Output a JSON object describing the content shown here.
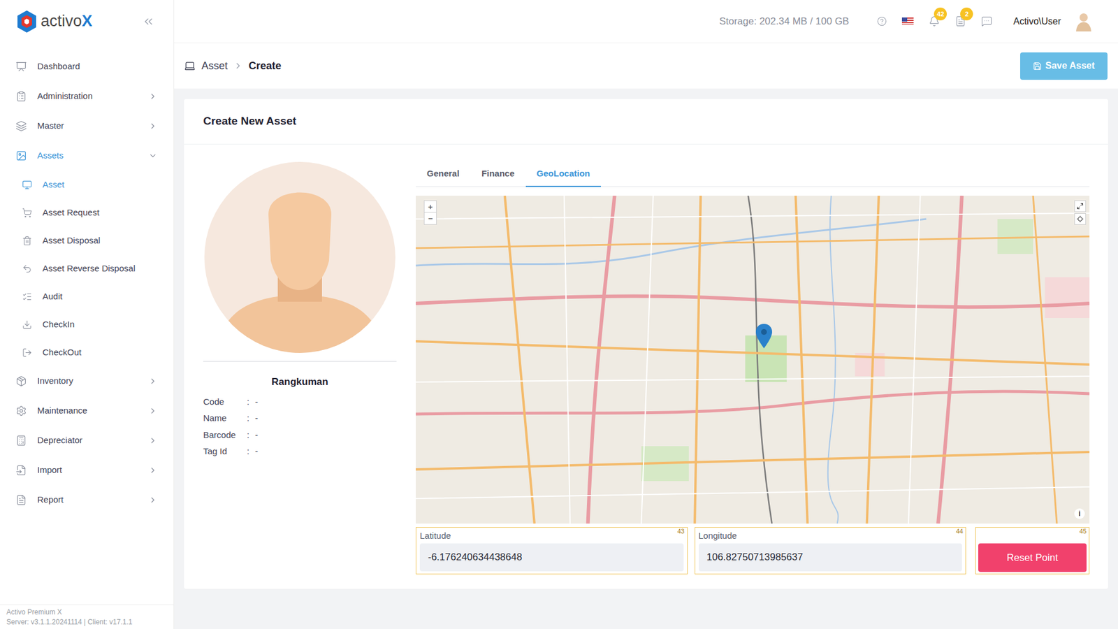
{
  "logo": {
    "text": "activo",
    "accent": "X"
  },
  "topbar": {
    "storage": "Storage: 202.34 MB / 100 GB",
    "notifications": "42",
    "tasks": "2",
    "user": "Activo\\User"
  },
  "breadcrumb": [
    "Asset",
    "Create"
  ],
  "save_button": "Save Asset",
  "sidebar": {
    "items": [
      {
        "label": "Dashboard",
        "kind": "item",
        "has_children": false,
        "expanded": false,
        "selected": false
      },
      {
        "label": "Administration",
        "kind": "item",
        "has_children": true,
        "expanded": false,
        "selected": false
      },
      {
        "label": "Master",
        "kind": "item",
        "has_children": true,
        "expanded": false,
        "selected": false
      },
      {
        "label": "Assets",
        "kind": "item",
        "has_children": true,
        "expanded": true,
        "selected": true
      },
      {
        "label": "Asset",
        "kind": "subitem",
        "has_children": false,
        "expanded": false,
        "selected": true
      },
      {
        "label": "Asset Request",
        "kind": "subitem",
        "has_children": false,
        "expanded": false,
        "selected": false
      },
      {
        "label": "Asset Disposal",
        "kind": "subitem",
        "has_children": false,
        "expanded": false,
        "selected": false
      },
      {
        "label": "Asset Reverse Disposal",
        "kind": "subitem",
        "has_children": false,
        "expanded": false,
        "selected": false
      },
      {
        "label": "Audit",
        "kind": "subitem",
        "has_children": false,
        "expanded": false,
        "selected": false
      },
      {
        "label": "CheckIn",
        "kind": "subitem",
        "has_children": false,
        "expanded": false,
        "selected": false
      },
      {
        "label": "CheckOut",
        "kind": "subitem",
        "has_children": false,
        "expanded": false,
        "selected": false
      },
      {
        "label": "Inventory",
        "kind": "item",
        "has_children": true,
        "expanded": false,
        "selected": false
      },
      {
        "label": "Maintenance",
        "kind": "item",
        "has_children": true,
        "expanded": false,
        "selected": false
      },
      {
        "label": "Depreciator",
        "kind": "item",
        "has_children": true,
        "expanded": false,
        "selected": false
      },
      {
        "label": "Import",
        "kind": "item",
        "has_children": true,
        "expanded": false,
        "selected": false
      },
      {
        "label": "Report",
        "kind": "item",
        "has_children": true,
        "expanded": false,
        "selected": false
      }
    ]
  },
  "footer": {
    "product": "Activo Premium X",
    "version": "Server: v3.1.1.20241114 | Client: v17.1.1"
  },
  "card": {
    "title": "Create New Asset"
  },
  "summary": {
    "title": "Rangkuman",
    "separator": ":",
    "rows": [
      {
        "label": "Code",
        "value": "-"
      },
      {
        "label": "Name",
        "value": "-"
      },
      {
        "label": "Barcode",
        "value": "-"
      },
      {
        "label": "Tag Id",
        "value": "-"
      }
    ]
  },
  "tabs": [
    {
      "label": "General",
      "selected": false
    },
    {
      "label": "Finance",
      "selected": false
    },
    {
      "label": "GeoLocation",
      "selected": true
    }
  ],
  "map": {
    "zoom_in": "+",
    "zoom_out": "−",
    "info": "i"
  },
  "fields": [
    {
      "label": "Latitude",
      "value": "-6.176240634438648",
      "marker": "43"
    },
    {
      "label": "Longitude",
      "value": "106.82750713985637",
      "marker": "44"
    }
  ],
  "reset_button": {
    "label": "Reset Point",
    "marker": "45"
  }
}
